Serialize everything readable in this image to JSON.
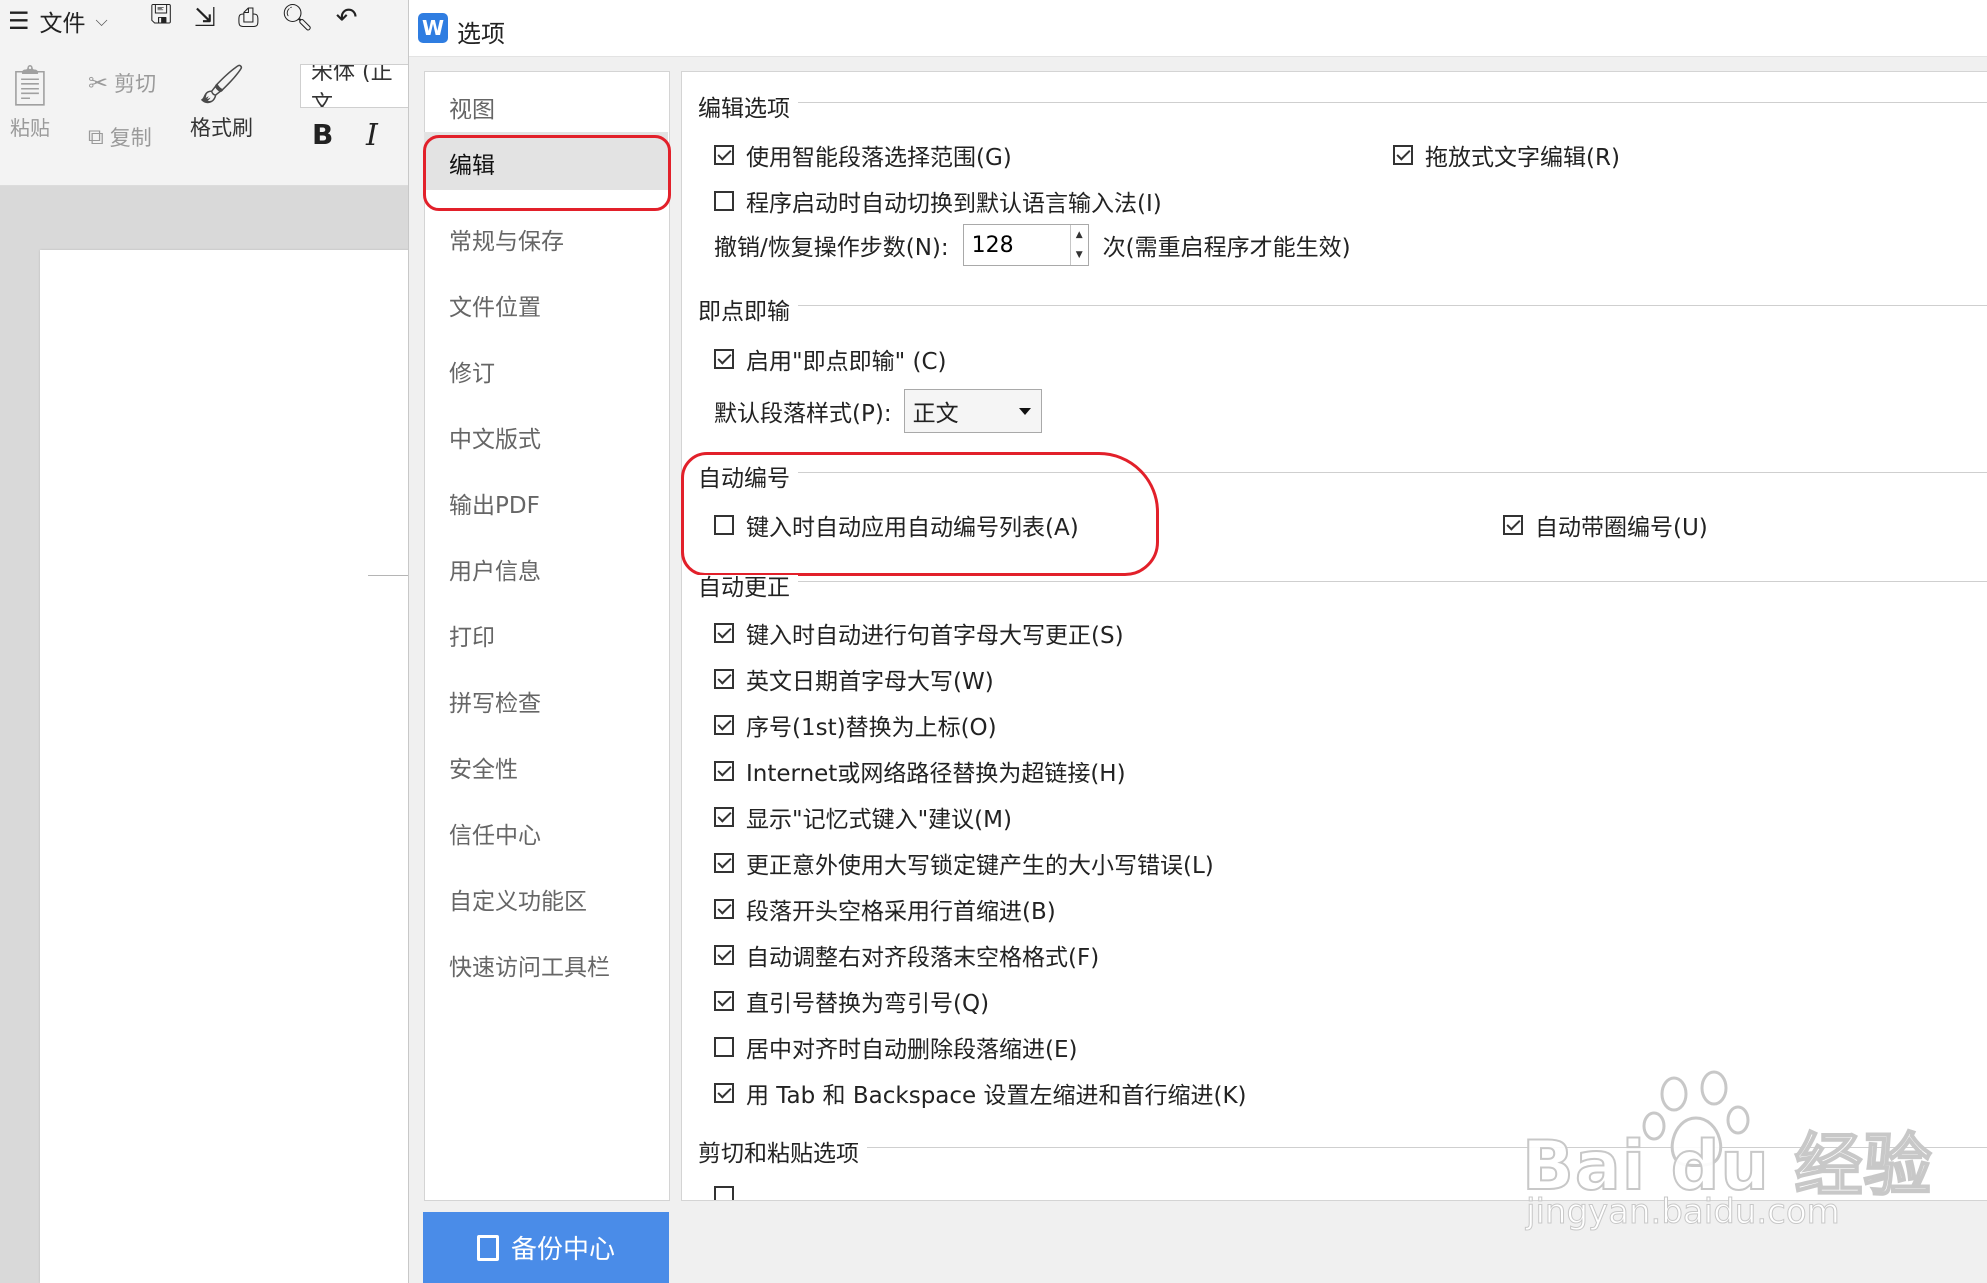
{
  "toolbar": {
    "menu_file": "文件",
    "cut": "剪切",
    "copy": "复制",
    "paste": "粘贴",
    "format_painter": "格式刷",
    "font": "宋体 (正文",
    "bold": "B",
    "italic": "I"
  },
  "dialog": {
    "title": "选项",
    "app_icon": "W",
    "nav": {
      "items": [
        {
          "label": "视图"
        },
        {
          "label": "编辑"
        },
        {
          "label": "常规与保存"
        },
        {
          "label": "文件位置"
        },
        {
          "label": "修订"
        },
        {
          "label": "中文版式"
        },
        {
          "label": "输出PDF"
        },
        {
          "label": "用户信息"
        },
        {
          "label": "打印"
        },
        {
          "label": "拼写检查"
        },
        {
          "label": "安全性"
        },
        {
          "label": "信任中心"
        },
        {
          "label": "自定义功能区"
        },
        {
          "label": "快速访问工具栏"
        }
      ],
      "active": "编辑"
    },
    "backup_button": "备份中心",
    "sections": {
      "edit_options": {
        "title": "编辑选项",
        "smart_para": {
          "label": "使用智能段落选择范围(G)",
          "checked": true
        },
        "drag_edit": {
          "label": "拖放式文字编辑(R)",
          "checked": true
        },
        "auto_ime": {
          "label": "程序启动时自动切换到默认语言输入法(I)",
          "checked": false
        },
        "undo_label": "撤销/恢复操作步数(N):",
        "undo_value": "128",
        "undo_suffix": "次(需重启程序才能生效)"
      },
      "click_type": {
        "title": "即点即输",
        "enable": {
          "label": "启用\"即点即输\" (C)",
          "checked": true
        },
        "default_style_label": "默认段落样式(P):",
        "default_style_value": "正文"
      },
      "auto_numbering": {
        "title": "自动编号",
        "auto_list": {
          "label": "键入时自动应用自动编号列表(A)",
          "checked": false
        },
        "circle_num": {
          "label": "自动带圈编号(U)",
          "checked": true
        }
      },
      "auto_correct": {
        "title": "自动更正",
        "items": [
          {
            "label": "键入时自动进行句首字母大写更正(S)",
            "checked": true
          },
          {
            "label": "英文日期首字母大写(W)",
            "checked": true
          },
          {
            "label": "序号(1st)替换为上标(O)",
            "checked": true
          },
          {
            "label": "Internet或网络路径替换为超链接(H)",
            "checked": true
          },
          {
            "label": "显示\"记忆式键入\"建议(M)",
            "checked": true
          },
          {
            "label": "更正意外使用大写锁定键产生的大小写错误(L)",
            "checked": true
          },
          {
            "label": "段落开头空格采用行首缩进(B)",
            "checked": true
          },
          {
            "label": "自动调整右对齐段落末空格格式(F)",
            "checked": true
          },
          {
            "label": "直引号替换为弯引号(Q)",
            "checked": true
          },
          {
            "label": "居中对齐时自动删除段落缩进(E)",
            "checked": false
          },
          {
            "label": "用 Tab 和 Backspace 设置左缩进和首行缩进(K)",
            "checked": true
          }
        ]
      },
      "cut_paste": {
        "title": "剪切和粘贴选项"
      }
    }
  },
  "watermark": {
    "brand": "Bai du 经验",
    "url": "jingyan.baidu.com"
  },
  "colors": {
    "accent": "#4a8ce8",
    "annotation": "#e2202a"
  }
}
